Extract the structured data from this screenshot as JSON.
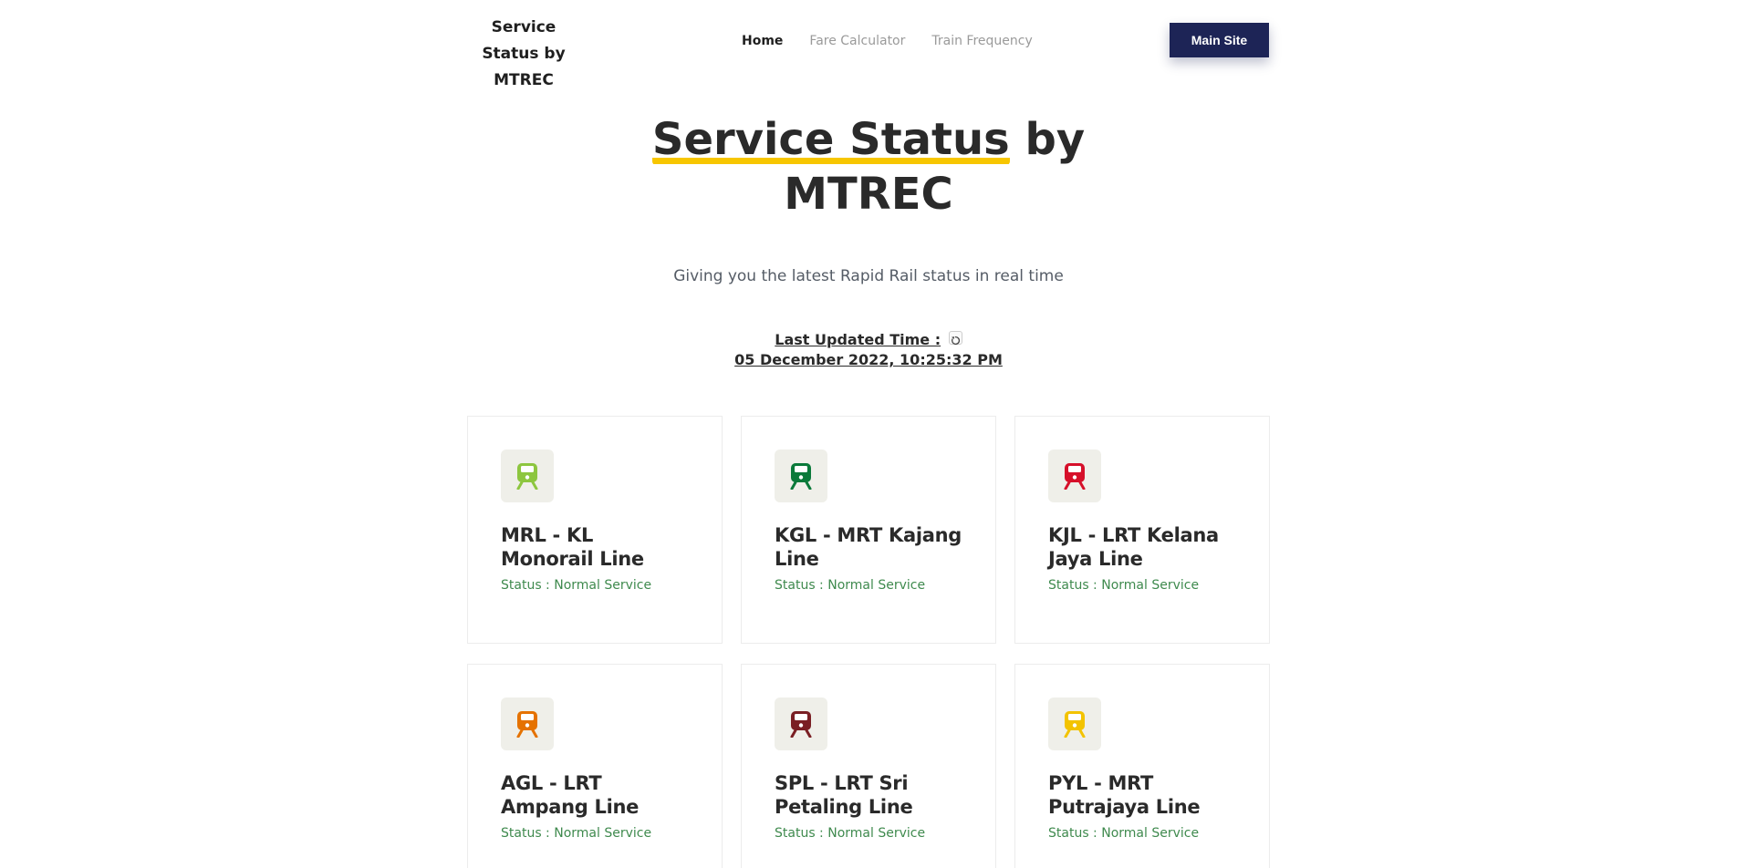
{
  "header": {
    "brand": "Service Status by MTREC",
    "nav": {
      "home": "Home",
      "fare_calculator": "Fare Calculator",
      "train_frequency": "Train Frequency"
    },
    "main_site": "Main Site"
  },
  "hero": {
    "title_highlight": "Service Status",
    "title_rest": " by MTREC",
    "subtitle": "Giving you the latest Rapid Rail status in real time",
    "updated_label": "Last Updated Time :",
    "updated_value": "05 December 2022, 10:25:32 PM",
    "refresh_icon": "refresh-icon"
  },
  "lines": [
    {
      "title": "MRL - KL Monorail Line",
      "status": "Status : Normal Service",
      "color": "#8dc63f",
      "icon": "train-icon"
    },
    {
      "title": "KGL - MRT Kajang Line",
      "status": "Status : Normal Service",
      "color": "#0b7a3a",
      "icon": "train-icon"
    },
    {
      "title": "KJL - LRT Kelana Jaya Line",
      "status": "Status : Normal Service",
      "color": "#d6102a",
      "icon": "train-icon"
    },
    {
      "title": "AGL - LRT Ampang Line",
      "status": "Status : Normal Service",
      "color": "#e57200",
      "icon": "train-icon"
    },
    {
      "title": "SPL - LRT Sri Petaling Line",
      "status": "Status : Normal Service",
      "color": "#7a1f24",
      "icon": "train-icon"
    },
    {
      "title": "PYL - MRT Putrajaya Line",
      "status": "Status : Normal Service",
      "color": "#f3c300",
      "icon": "train-icon"
    }
  ]
}
